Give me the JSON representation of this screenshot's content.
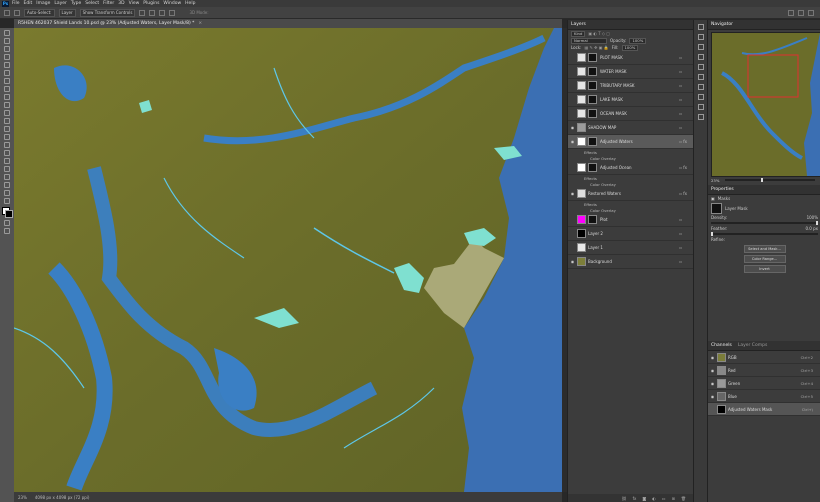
{
  "window": {
    "title": "R5HEN 462037 Shield Lands 10.psd @ 23% (Adjusted Waters, Layer Mask/8) *"
  },
  "menubar": [
    "File",
    "Edit",
    "Image",
    "Layer",
    "Type",
    "Select",
    "Filter",
    "3D",
    "View",
    "Plugins",
    "Window",
    "Help"
  ],
  "options": {
    "auto_select_label": "Auto-Select:",
    "auto_select_value": "Layer",
    "transform_label": "Show Transform Controls",
    "mode_3d": "3D Mode:"
  },
  "layers_panel": {
    "tab": "Layers",
    "kind_label": "Kind",
    "blend_mode": "Normal",
    "opacity_label": "Opacity:",
    "opacity_value": "100%",
    "lock_label": "Lock:",
    "fill_label": "Fill:",
    "fill_value": "100%",
    "layers": [
      {
        "name": "PLOT MASK",
        "visible": false,
        "thumb": "#e6e6e6",
        "mask": "#111"
      },
      {
        "name": "WATER MASK",
        "visible": false,
        "thumb": "#e6e6e6",
        "mask": "#111"
      },
      {
        "name": "TRIBUTARY MASK",
        "visible": false,
        "thumb": "#e6e6e6",
        "mask": "#111"
      },
      {
        "name": "LAKE MASK",
        "visible": false,
        "thumb": "#e6e6e6",
        "mask": "#111"
      },
      {
        "name": "OCEAN MASK",
        "visible": false,
        "thumb": "#e6e6e6",
        "mask": "#111"
      },
      {
        "name": "SHADOW MAP",
        "visible": true,
        "thumb": "#9c9c9c",
        "mask": null
      },
      {
        "name": "Adjusted Waters",
        "visible": true,
        "thumb": "#ffffff",
        "mask": "#111",
        "selected": true,
        "sub": [
          "Effects",
          "Color Overlay"
        ]
      },
      {
        "name": "Adjusted Ocean",
        "visible": false,
        "thumb": "#ffffff",
        "mask": "#111",
        "sub": [
          "Effects",
          "Color Overlay"
        ]
      },
      {
        "name": "Restored Waters",
        "visible": true,
        "thumb": "#dddddd",
        "mask": null,
        "sub": [
          "Effects",
          "Color Overlay"
        ]
      },
      {
        "name": "Plot",
        "visible": false,
        "thumb": "#ff00ff",
        "mask": "#111"
      },
      {
        "name": "Layer 2",
        "visible": false,
        "thumb": "#000000",
        "mask": null
      },
      {
        "name": "Layer 1",
        "visible": false,
        "thumb": "#e8e8e8",
        "mask": null
      },
      {
        "name": "Background",
        "visible": true,
        "thumb": "#7d7f3a",
        "mask": null
      }
    ]
  },
  "navigator": {
    "tab": "Navigator",
    "zoom": "23%"
  },
  "properties": {
    "tab": "Properties",
    "section": "Masks",
    "mask_label": "Layer Mask",
    "density_label": "Density:",
    "density_value": "100%",
    "feather_label": "Feather:",
    "feather_value": "0.0 px",
    "refine_label": "Refine:",
    "btn1": "Select and Mask...",
    "btn2": "Color Range...",
    "btn3": "Invert"
  },
  "channels_panel": {
    "tabs": [
      "Channels",
      "Layer Comps"
    ],
    "rows": [
      {
        "name": "RGB",
        "shortcut": "Ctrl+2",
        "thumb": "#7b7d3a"
      },
      {
        "name": "Red",
        "shortcut": "Ctrl+3",
        "thumb": "#888"
      },
      {
        "name": "Green",
        "shortcut": "Ctrl+4",
        "thumb": "#999"
      },
      {
        "name": "Blue",
        "shortcut": "Ctrl+5",
        "thumb": "#666"
      },
      {
        "name": "Adjusted Waters Mask",
        "shortcut": "Ctrl+\\",
        "thumb": "#000",
        "selected": true
      }
    ]
  },
  "status": {
    "zoom": "23%",
    "doc": "4098 px x 4098 px (72 ppi)"
  },
  "colors": {
    "land": "#6b6d2a",
    "water": "#3a7fc4",
    "highlight": "#7fe0d0",
    "ocean": "#3b6fb3"
  }
}
